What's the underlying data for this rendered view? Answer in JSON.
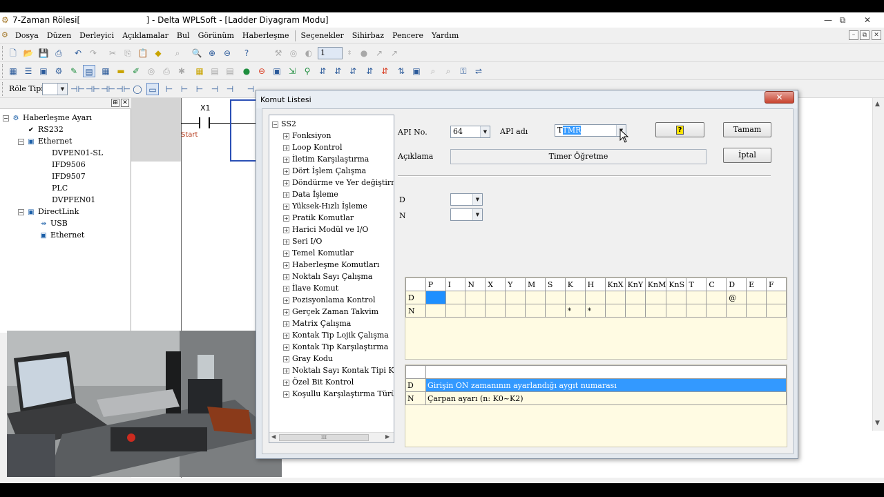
{
  "window": {
    "title": "7-Zaman Rölesi[                         ] - Delta WPLSoft - [Ladder Diyagram Modu]",
    "controls": [
      "—",
      "⧉",
      "✕"
    ]
  },
  "menu": {
    "items": [
      "Dosya",
      "Düzen",
      "Derleyici",
      "Açıklamalar",
      "Bul",
      "Görünüm",
      "Haberleşme",
      "Seçenekler",
      "Sihirbaz",
      "Pencere",
      "Yardım"
    ],
    "mdi_controls": [
      "–",
      "⧉",
      "✕"
    ]
  },
  "toolbar3": {
    "role_label": "Röle Tipi",
    "role_value": ""
  },
  "toolbar1": {
    "step_value": "1"
  },
  "left_tree": {
    "items": [
      {
        "label": "Haberleşme Ayarı",
        "icon": "network-root-icon"
      },
      {
        "label": "RS232",
        "icon": "check-icon"
      },
      {
        "label": "Ethernet",
        "icon": "ethernet-icon"
      },
      {
        "label": "DVPEN01-SL",
        "icon": "none"
      },
      {
        "label": "IFD9506",
        "icon": "none"
      },
      {
        "label": "IFD9507",
        "icon": "none"
      },
      {
        "label": "PLC",
        "icon": "none"
      },
      {
        "label": "DVPFEN01",
        "icon": "none"
      },
      {
        "label": "DirectLink",
        "icon": "directlink-icon"
      },
      {
        "label": "USB",
        "icon": "usb-icon"
      },
      {
        "label": "Ethernet",
        "icon": "ethernet-icon"
      }
    ]
  },
  "ladder": {
    "contact_label": "X1",
    "contact_comment": "Start"
  },
  "dialog": {
    "title": "Komut Listesi",
    "close": "✕",
    "tree_root": "SS2",
    "tree_items": [
      "Fonksiyon",
      "Loop Kontrol",
      "İletim Karşılaştırma",
      "Dört İşlem Çalışma",
      "Döndürme ve Yer değiştirme",
      "Data İşleme",
      "Yüksek-Hızlı İşleme",
      "Pratik Komutlar",
      "Harici Modül ve I/O",
      "Seri I/O",
      "Temel Komutlar",
      "Haberleşme Komutları",
      "Noktalı Sayı Çalışma",
      "İlave Komut",
      "Pozisyonlama Kontrol",
      "Gerçek Zaman Takvim",
      "Matrix Çalışma",
      "Kontak Tip Lojik Çalışma",
      "Kontak Tip Karşılaştırma",
      "Gray Kodu",
      "Noktalı Sayı Kontak Tipi Karşılaştırma",
      "Özel Bit Kontrol",
      "Koşullu Karşılaştırma Türü"
    ],
    "tree_scroll_thumb": "III",
    "api_no_label": "API No.",
    "api_no_value": "64",
    "api_name_label": "API adı",
    "api_name_prefix": "T",
    "api_name_selected": "TMR",
    "help_button": "?",
    "ok_button": "Tamam",
    "cancel_button": "İptal",
    "desc_label": "Açıklama",
    "desc_value": "Timer Öğretme",
    "operands": [
      {
        "label": "D",
        "value": ""
      },
      {
        "label": "N",
        "value": ""
      }
    ],
    "operand_grid": {
      "columns": [
        "",
        "P",
        "I",
        "N",
        "X",
        "Y",
        "M",
        "S",
        "K",
        "H",
        "KnX",
        "KnY",
        "KnM",
        "KnS",
        "T",
        "C",
        "D",
        "E",
        "F"
      ],
      "rows": [
        [
          "D",
          "",
          "",
          "",
          "",
          "",
          "",
          "",
          "",
          "",
          "",
          "",
          "",
          "",
          "",
          "",
          "@",
          "",
          ""
        ],
        [
          "N",
          "",
          "",
          "",
          "",
          "",
          "",
          "",
          "*",
          "*",
          "",
          "",
          "",
          "",
          "",
          "",
          "",
          "",
          ""
        ]
      ]
    },
    "desc_grid": {
      "rows": [
        {
          "op": "D",
          "text": "Girişin ON zamanının ayarlandığı aygıt numarası"
        },
        {
          "op": "N",
          "text": "Çarpan ayarı (n: K0~K2)"
        }
      ]
    }
  }
}
